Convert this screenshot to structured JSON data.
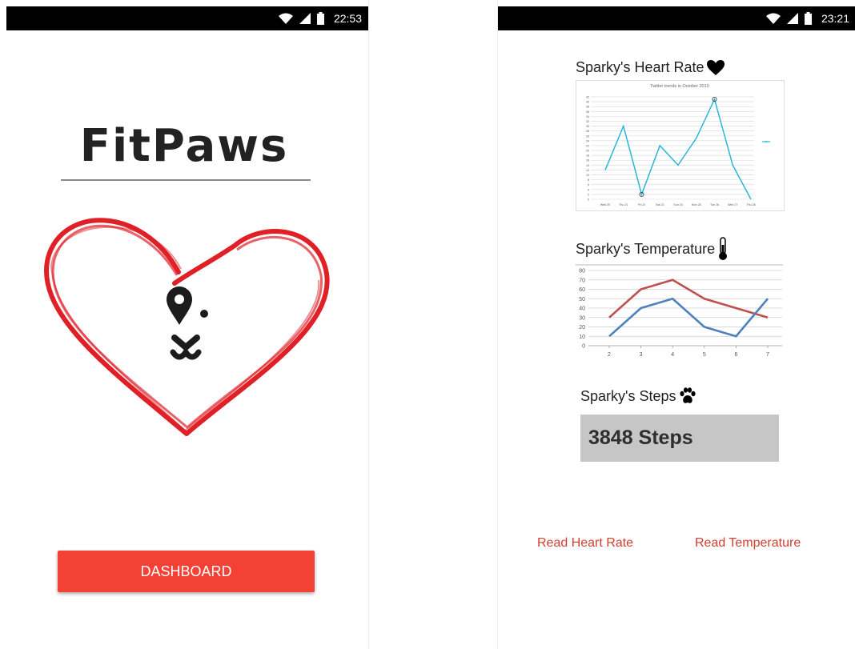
{
  "colors": {
    "accent": "#f34235",
    "link": "#d23f31",
    "heart_red": "#e02027",
    "status_bar": "#000000",
    "steps_box": "#c6c6c6"
  },
  "screen_left": {
    "status_bar": {
      "time": "22:53",
      "icons": [
        "wifi-icon",
        "signal-icon",
        "battery-icon"
      ]
    },
    "logo": {
      "title": "FitPaws",
      "art": "heart-with-dog-face"
    },
    "dashboard_button": {
      "label": "DASHBOARD"
    }
  },
  "screen_right": {
    "status_bar": {
      "time": "23:21",
      "icons": [
        "wifi-icon",
        "signal-icon",
        "battery-icon"
      ]
    },
    "heart_rate": {
      "title": "Sparky's Heart Rate",
      "icon": "heart-icon"
    },
    "temperature": {
      "title": "Sparky's Temperature",
      "icon": "thermometer-icon"
    },
    "steps": {
      "title": "Sparky's Steps",
      "icon": "paw-icon",
      "value": "3848 Steps"
    },
    "actions": {
      "read_heart_rate": "Read Heart Rate",
      "read_temperature": "Read Temperature"
    }
  },
  "chart_data": [
    {
      "type": "line",
      "title": "Twitter trends in October 2010",
      "categories": [
        "Wed 20",
        "Thu 21",
        "Fri 22",
        "Sat 23",
        "Sun 24",
        "Mon 25",
        "Tue 26",
        "Wed 27",
        "Thu 28"
      ],
      "series": [
        {
          "name": "",
          "values": [
            12,
            30,
            2,
            22,
            14,
            25,
            41,
            14,
            0
          ],
          "color": "#2ab6d6"
        }
      ],
      "ylim": [
        0,
        42
      ],
      "yticks": [
        0,
        2,
        4,
        6,
        8,
        10,
        12,
        14,
        16,
        18,
        20,
        22,
        24,
        26,
        28,
        30,
        32,
        34,
        36,
        38,
        40,
        42
      ],
      "grid": true,
      "legend": "right"
    },
    {
      "type": "line",
      "categories": [
        "2",
        "3",
        "4",
        "5",
        "6",
        "7"
      ],
      "series": [
        {
          "name": "",
          "values": [
            30,
            60,
            70,
            50,
            40,
            30
          ],
          "color": "#c0504d"
        },
        {
          "name": "",
          "values": [
            10,
            40,
            50,
            20,
            10,
            50
          ],
          "color": "#4f81bd"
        }
      ],
      "ylim": [
        0,
        80
      ],
      "yticks": [
        0,
        10,
        20,
        30,
        40,
        50,
        60,
        70,
        80
      ],
      "grid": true
    }
  ]
}
